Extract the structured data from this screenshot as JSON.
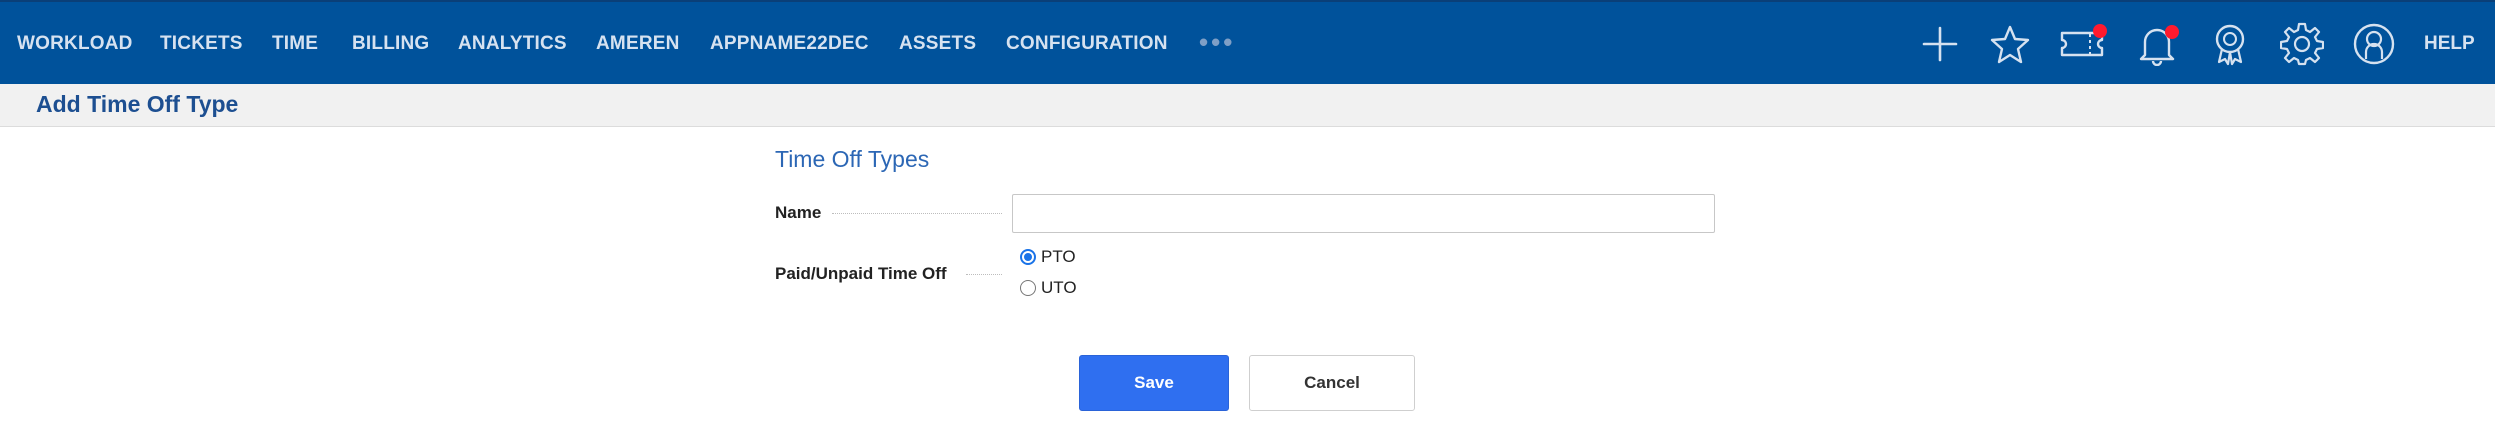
{
  "nav": {
    "items": [
      {
        "label": "WORKLOAD"
      },
      {
        "label": "TICKETS"
      },
      {
        "label": "TIME"
      },
      {
        "label": "BILLING"
      },
      {
        "label": "ANALYTICS"
      },
      {
        "label": "AMEREN"
      },
      {
        "label": "APPNAME22DEC"
      },
      {
        "label": "ASSETS"
      },
      {
        "label": "CONFIGURATION"
      }
    ],
    "more": "•••",
    "tools": [
      {
        "icon": "plus-icon"
      },
      {
        "icon": "star-icon"
      },
      {
        "icon": "ticket-icon",
        "badge": true
      },
      {
        "icon": "bell-icon",
        "badge": true
      },
      {
        "icon": "award-icon"
      },
      {
        "icon": "gear-icon"
      },
      {
        "icon": "user-icon"
      }
    ],
    "help": "HELP",
    "badge_color": "#ff1a2e",
    "bar_color": "#00529b"
  },
  "page": {
    "title": "Add Time Off Type"
  },
  "form": {
    "section_title": "Time Off Types",
    "name_label": "Name",
    "name_value": "",
    "paid_label": "Paid/Unpaid Time Off",
    "options": [
      {
        "label": "PTO",
        "checked": true
      },
      {
        "label": "UTO",
        "checked": false
      }
    ],
    "save_label": "Save",
    "cancel_label": "Cancel"
  }
}
